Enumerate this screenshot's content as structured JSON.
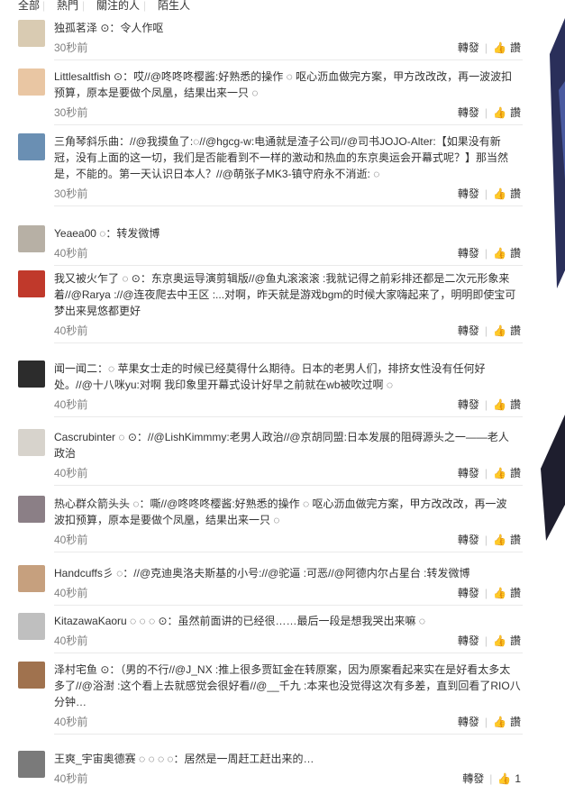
{
  "tabs": [
    "全部",
    "熱門",
    "關注的人",
    "陌生人"
  ],
  "actions": {
    "repost": "轉發",
    "like": "讚"
  },
  "comments": [
    {
      "avatar": "#d9cbb2",
      "text": [
        "独孤茗泽 ⊙：令人作呕"
      ],
      "time": "30秒前",
      "likes": ""
    },
    {
      "avatar": "#e9c6a3",
      "text": [
        "Littlesaltfish ⊙：哎//@咚咚咚樱酱:好熟悉的操作 ◌ 呕心沥血做完方案，甲方改改改，再一波波扣",
        "预算，原本是要做个凤凰，结果出来一只 ◌"
      ],
      "time": "30秒前",
      "likes": ""
    },
    {
      "avatar": "#6a8fb3",
      "text": [
        "三角琴斜乐曲：//@我摸鱼了:◌//@hgcg-w:电通就是渣子公司//@司书JOJO-Alter:【如果没有新",
        "冠，没有上面的这一切，我们是否能看到不一样的激动和热血的东京奥运会开幕式呢？】那当然",
        "是，不能的。第一天认识日本人？//@萌张子MK3-镇守府永不消逝: ◌"
      ],
      "time": "30秒前",
      "likes": ""
    },
    {
      "avatar": "#b7b0a5",
      "text": [
        "Yeaea00 ◌：转发微博"
      ],
      "time": "40秒前",
      "likes": ""
    },
    {
      "avatar": "#c0392b",
      "text": [
        "我又被火乍了 ◌ ⊙：东京奥运导演剪辑版//@鱼丸滚滚滚 :我就记得之前彩排还都是二次元形象来",
        "着//@Rarya ://@连夜爬去中王区 :...对啊，昨天就是游戏bgm的时候大家嗨起来了，明明即使宝可",
        "梦出来晃悠都更好"
      ],
      "time": "40秒前",
      "likes": ""
    },
    {
      "avatar": "#2c2c2c",
      "text": [
        "闻一闻二：◌ 苹果女士走的时候已经莫得什么期待。日本的老男人们，排挤女性没有任何好",
        "处。//@十八咪yu:对啊 我印象里开幕式设计好早之前就在wb被吹过啊 ◌"
      ],
      "time": "40秒前",
      "likes": ""
    },
    {
      "avatar": "#d7d3cc",
      "text": [
        "Cascrubinter ◌ ⊙：//@LishKimmmy:老男人政治//@京胡同盟:日本发展的阻碍源头之一——老人",
        "政治"
      ],
      "time": "40秒前",
      "likes": ""
    },
    {
      "avatar": "#8b7f86",
      "text": [
        "热心群众箭头头 ◌：嘶//@咚咚咚樱酱:好熟悉的操作 ◌ 呕心沥血做完方案，甲方改改改，再一波",
        "波扣预算，原本是要做个凤凰，结果出来一只 ◌"
      ],
      "time": "40秒前",
      "likes": ""
    },
    {
      "avatar": "#c6a07e",
      "text": [
        "Handcuffs彡 ◌：//@克迪奥洛夫斯基的小号://@驼逼 :可恶//@阿德内尔占星台 :转发微博"
      ],
      "time": "40秒前",
      "likes": ""
    },
    {
      "avatar": "#bfbfbf",
      "text": [
        "KitazawaKaoru ◌ ◌ ◌ ⊙：虽然前面讲的已经很……最后一段是想我哭出来嘛 ◌"
      ],
      "time": "40秒前",
      "likes": ""
    },
    {
      "avatar": "#a0724e",
      "text": [
        "泽村宅鱼 ⊙：（男的不行//@J_NX :推上很多贾缸金在转原案，因为原案看起来实在是好看太多太",
        "多了//@浴澍 :这个看上去就感觉会很好看//@__千九 :本来也没觉得这次有多差，直到回看了RIO八",
        "分钟…"
      ],
      "time": "40秒前",
      "likes": ""
    },
    {
      "avatar": "#7a7a7a",
      "text": [
        "王爽_宇宙奥德赛 ◌ ◌ ◌ ◌：居然是一周赶工赶出来的…"
      ],
      "time": "40秒前",
      "likes": "1"
    }
  ]
}
